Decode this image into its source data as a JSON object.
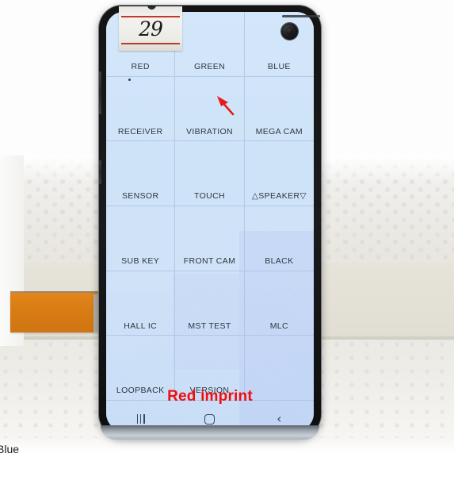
{
  "scene": {
    "description_caption": "Blue",
    "annotation_caption": "Red imprint"
  },
  "tape_label": {
    "handwritten_number": "29"
  },
  "phone": {
    "screen": {
      "background_color": "#cfe3f8",
      "grid": {
        "columns": 3,
        "rows": 6,
        "items": [
          {
            "label": "RED"
          },
          {
            "label": "GREEN"
          },
          {
            "label": "BLUE"
          },
          {
            "label": "RECEIVER"
          },
          {
            "label": "VIBRATION"
          },
          {
            "label": "MEGA CAM"
          },
          {
            "label": "SENSOR"
          },
          {
            "label": "TOUCH"
          },
          {
            "label": "△SPEAKER▽"
          },
          {
            "label": "SUB KEY"
          },
          {
            "label": "FRONT CAM"
          },
          {
            "label": "BLACK"
          },
          {
            "label": "HALL IC"
          },
          {
            "label": "MST TEST"
          },
          {
            "label": "MLC"
          },
          {
            "label": "LOOPBACK"
          },
          {
            "label": "VERSION"
          },
          {
            "label": ""
          }
        ]
      },
      "navbar": {
        "recents_label": "recents",
        "home_label": "home",
        "back_label": "‹"
      }
    }
  },
  "annotations": {
    "arrow_color": "#e41b1b",
    "defect_dot_color": "#1f3a7a",
    "imprint_text_color": "#f20d0d"
  }
}
